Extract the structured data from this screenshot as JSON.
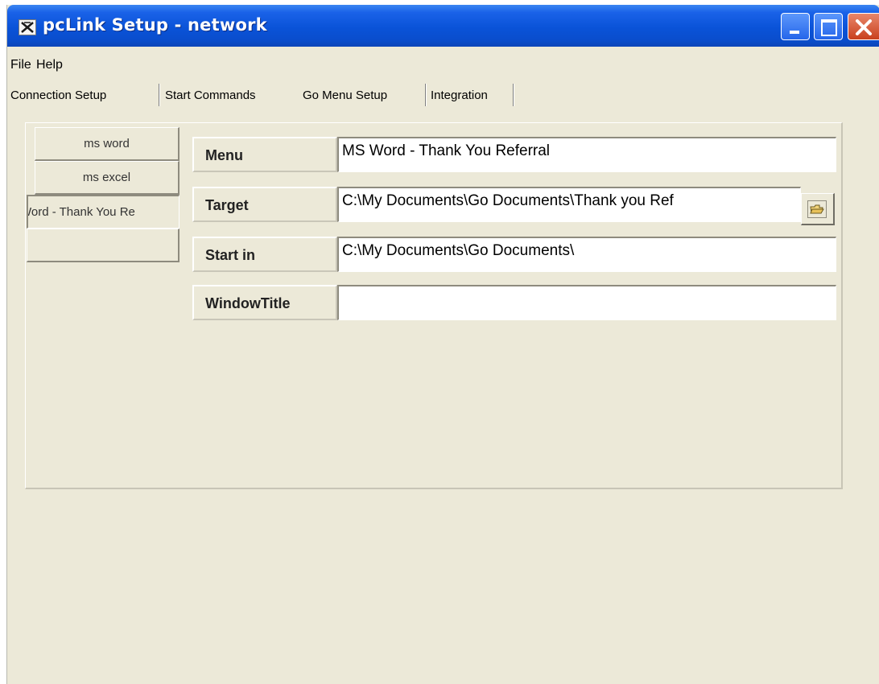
{
  "window": {
    "title": "pcLink Setup - network"
  },
  "menu": {
    "file": "File",
    "help": "Help"
  },
  "tabs": [
    {
      "label": "Connection Setup"
    },
    {
      "label": "Start Commands"
    },
    {
      "label": "Go Menu Setup",
      "active": true
    },
    {
      "label": "Integration"
    }
  ],
  "list_items": [
    {
      "label": "ms word"
    },
    {
      "label": "ms excel"
    },
    {
      "label": "Word - Thank You Re",
      "selected": true
    },
    {
      "label": ""
    }
  ],
  "form": {
    "menu_label": "Menu",
    "menu_value": "MS Word - Thank You Referral",
    "target_label": "Target",
    "target_value": "C:\\My Documents\\Go Documents\\Thank you Ref",
    "start_in_label": "Start in",
    "start_in_value": "C:\\My Documents\\Go Documents\\",
    "window_title_label": "WindowTitle",
    "window_title_value": ""
  },
  "icons": {
    "app": "pclink-app-icon",
    "browse": "folder-open-icon"
  },
  "colors": {
    "titlebar": "#0a53d8",
    "face": "#ece9d8",
    "close": "#c9411d"
  }
}
